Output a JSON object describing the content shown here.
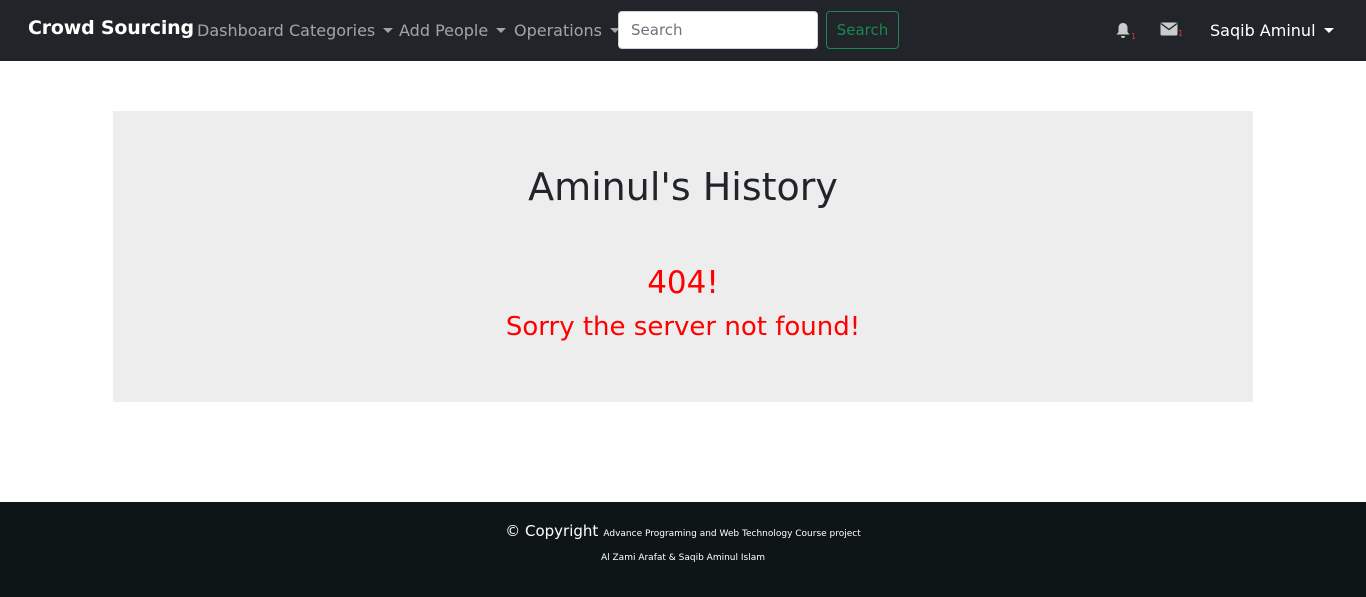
{
  "navbar": {
    "brand": "Crowd Sourcing",
    "links": [
      {
        "label": "Dashboard"
      },
      {
        "label": "Categories"
      },
      {
        "label": "Add People"
      },
      {
        "label": "Operations"
      }
    ],
    "search": {
      "placeholder": "Search",
      "button_label": "Search"
    },
    "notifications": {
      "icon": "bell-icon",
      "count": "1"
    },
    "messages": {
      "icon": "envelope-icon",
      "count": "1"
    },
    "user": {
      "name": "Saqib Aminul"
    }
  },
  "main": {
    "title": "Aminul's History",
    "error_code": "404!",
    "error_message": "Sorry the server not found!"
  },
  "footer": {
    "copyright_label": "© Copyright",
    "project": "Advance Programing and Web Technology Course project",
    "authors": "Al Zami Arafat & Saqib Aminul Islam"
  },
  "colors": {
    "navbar_bg": "#212529",
    "accent_green": "#198754",
    "error_red": "#ff0000",
    "footer_bg": "#0d1517",
    "panel_bg": "#ededed"
  }
}
